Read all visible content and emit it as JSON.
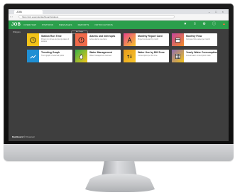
{
  "browser": {
    "tab_title": "JOB",
    "url": "https://job.example/dashboard/widgets",
    "window_controls": "– □ ×"
  },
  "app": {
    "logo": "JOB",
    "nav": [
      "Overview",
      "Stations",
      "Messages",
      "Reports",
      "Notifications"
    ],
    "header_icons": [
      "filter-icon",
      "upload-icon",
      "settings-icon",
      "info-icon",
      "alert-icon"
    ],
    "accent_color": "#2b9f4c"
  },
  "subbar": {
    "breadcrumb": "Widgets",
    "pill_label": "Add Widget"
  },
  "tiles": [
    {
      "title": "Station Run Time",
      "desc": "Project run times and pump status of stations",
      "icon": "clock-icon",
      "color": "#f2c318"
    },
    {
      "title": "Alarms and Interrupts",
      "desc": "Active alarms overview",
      "icon": "warning-icon",
      "color": "#f06a4a"
    },
    {
      "title": "Monthly Report Card",
      "desc": "Project scorecard by month",
      "icon": "grade-icon",
      "color": "#e8418a"
    },
    {
      "title": "Monthly Flow",
      "desc": "Compare flow values per month",
      "icon": "calendar-icon",
      "color": "#c2439c"
    },
    {
      "title": "Trending Graph",
      "desc": "Trend graph of selected points",
      "icon": "trend-icon",
      "color": "#1f8fd4"
    },
    {
      "title": "Water Management",
      "desc": "Water management overview",
      "icon": "water-icon",
      "color": "#38b34a"
    },
    {
      "title": "Water Use by Bill Zone",
      "desc": "Consumption per bill zone",
      "icon": "zone-icon",
      "color": "#e89a1a"
    },
    {
      "title": "Yearly Water Consumption",
      "desc": "Annual water consumption totals",
      "icon": "table-icon",
      "color": "#8e6db5"
    }
  ],
  "footer": {
    "brand": "Dashboard",
    "text": "© Powered"
  }
}
